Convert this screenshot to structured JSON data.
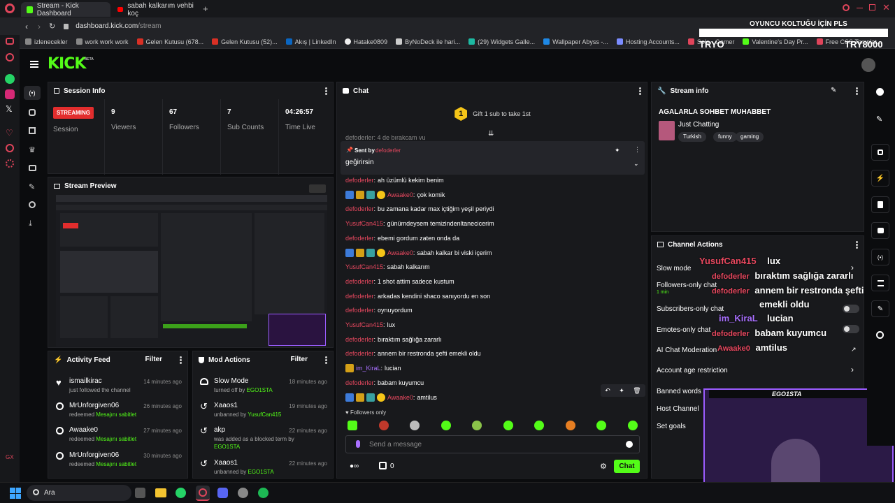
{
  "browser": {
    "tabs": [
      {
        "label": "Stream - Kick Dashboard",
        "active": true
      },
      {
        "label": "sabah kalkarım vehbi koç",
        "active": false
      }
    ],
    "url_domain": "dashboard.kick.com",
    "url_path": "/stream",
    "bookmarks": [
      "izlenecekler",
      "work work work",
      "Gelen Kutusu (678...",
      "Gelen Kutusu (52)...",
      "Akış | LinkedIn",
      "Hatake0809",
      "ByNoDeck ile hari...",
      "(29) Widgets Galle...",
      "Wallpaper Abyss -...",
      "Hosting Accounts...",
      "Solo - Gamer",
      "Valentine's Day Pr...",
      "Free CSS Templat..."
    ]
  },
  "overlay": {
    "banner": "OYUNCU KOLTUĞU İÇİN PLS",
    "left_tag": "TRYO",
    "right_tag": "TRY8000",
    "cam_label": "EGO1STA"
  },
  "header": {
    "logo": "KICK",
    "beta": "BETA"
  },
  "session": {
    "title": "Session Info",
    "status": "STREAMING",
    "status_label": "Session",
    "stats": [
      {
        "value": "9",
        "label": "Viewers"
      },
      {
        "value": "67",
        "label": "Followers"
      },
      {
        "value": "7",
        "label": "Sub Counts"
      },
      {
        "value": "04:26:57",
        "label": "Time Live"
      }
    ]
  },
  "preview": {
    "title": "Stream Preview"
  },
  "activity": {
    "title": "Activity Feed",
    "filter": "Filter",
    "items": [
      {
        "name": "ismailkirac",
        "action": "just followed the channel",
        "highlight": "",
        "time": "14 minutes ago"
      },
      {
        "name": "MrUnforgiven06",
        "action": "redeemed",
        "highlight": "Mesajını sabitlet",
        "time": "26 minutes ago"
      },
      {
        "name": "Awaake0",
        "action": "redeemed",
        "highlight": "Mesajını sabitlet",
        "time": "27 minutes ago"
      },
      {
        "name": "MrUnforgiven06",
        "action": "redeemed",
        "highlight": "Mesajını sabitlet",
        "time": "30 minutes ago"
      }
    ]
  },
  "mod": {
    "title": "Mod Actions",
    "filter": "Filter",
    "items": [
      {
        "name": "Slow Mode",
        "line1": "turned off by",
        "by": "EGO1STA",
        "time": "18 minutes ago"
      },
      {
        "name": "Xaaos1",
        "line1": "unbanned by",
        "by": "YusufCan415",
        "time": "19 minutes ago"
      },
      {
        "name": "akp",
        "line1": "was added as a blocked term by",
        "by": "EGO1STA",
        "time": "22 minutes ago"
      },
      {
        "name": "Xaaos1",
        "line1": "unbanned by",
        "by": "EGO1STA",
        "time": "22 minutes ago"
      }
    ]
  },
  "chat": {
    "title": "Chat",
    "gift_count": "1",
    "gift_text": "Gift 1 sub to take 1st",
    "cut_line": "defoderler: 4 de bırakcam yu",
    "pinned": {
      "sent_by_label": "Sent by",
      "sent_by": "defoderler",
      "text": "geğirirsin"
    },
    "messages": [
      {
        "user": "defoderler",
        "color": "#e8485f",
        "text": "ah üzümlü kekim benim",
        "badges": false
      },
      {
        "user": "Awaake0",
        "color": "#e8485f",
        "text": "çok komik",
        "badges": true
      },
      {
        "user": "defoderler",
        "color": "#e8485f",
        "text": "bu zamana kadar max içtiğim yeşil periydi",
        "badges": false
      },
      {
        "user": "YusufCan415",
        "color": "#e8485f",
        "text": "günümdeysem temizindenltanecicerim",
        "badges": false
      },
      {
        "user": "defoderler",
        "color": "#e8485f",
        "text": "ebemi gordum zaten onda da",
        "badges": false
      },
      {
        "user": "Awaake0",
        "color": "#e8485f",
        "text": "sabah kalkar bi viski içerim",
        "badges": true
      },
      {
        "user": "YusufCan415",
        "color": "#e8485f",
        "text": "sabah kalkarım",
        "badges": false
      },
      {
        "user": "defoderler",
        "color": "#e8485f",
        "text": "1 shot attim sadece kustum",
        "badges": false
      },
      {
        "user": "defoderler",
        "color": "#e8485f",
        "text": "arkadas kendini shaco sanıyordu en son",
        "badges": false
      },
      {
        "user": "defoderler",
        "color": "#e8485f",
        "text": "oynuyordum",
        "badges": false
      },
      {
        "user": "YusufCan415",
        "color": "#e8485f",
        "text": "lux",
        "badges": false
      },
      {
        "user": "defoderler",
        "color": "#e8485f",
        "text": "bıraktım sağlığa zararlı",
        "badges": false
      },
      {
        "user": "defoderler",
        "color": "#e8485f",
        "text": "annem bir restronda şefti emekli oldu",
        "badges": false
      },
      {
        "user": "im_KiraL",
        "color": "#a970ff",
        "text": "lucian",
        "badges": false
      },
      {
        "user": "defoderler",
        "color": "#e8485f",
        "text": "babam kuyumcu",
        "badges": false
      },
      {
        "user": "Awaake0",
        "color": "#e8485f",
        "text": "amtilus",
        "badges": true
      }
    ],
    "followers_only": "Followers only",
    "input_placeholder": "Send a message",
    "points": "0",
    "send": "Chat"
  },
  "stream_info": {
    "title": "Stream info",
    "stream_title": "AGALARLA SOHBET MUHABBET",
    "category": "Just Chatting",
    "tags": [
      "Turkish",
      "funny",
      "gaming"
    ]
  },
  "channel_actions": {
    "title": "Channel Actions",
    "rows": [
      {
        "label": "Slow mode",
        "sub": ""
      },
      {
        "label": "Followers-only chat",
        "sub": "1 min"
      },
      {
        "label": "Subscribers-only chat",
        "sub": ""
      },
      {
        "label": "Emotes-only chat",
        "sub": ""
      },
      {
        "label": "AI Chat Moderation",
        "sub": ""
      },
      {
        "label": "Account age restriction",
        "sub": ""
      },
      {
        "label": "Banned words",
        "sub": ""
      },
      {
        "label": "Host Channel",
        "sub": ""
      },
      {
        "label": "Set goals",
        "sub": ""
      }
    ]
  },
  "chat_overlay": [
    {
      "user": "YusufCan415",
      "text": "lux"
    },
    {
      "user": "defoderler",
      "text": "bıraktım sağlığa zararlı"
    },
    {
      "user": "defoderler",
      "text": "annem bir restronda şefti"
    },
    {
      "user": "",
      "text": "emekli oldu"
    },
    {
      "user": "im_KiraL",
      "text": "lucian"
    },
    {
      "user": "defoderler",
      "text": "babam kuyumcu"
    },
    {
      "user": "Awaake0",
      "text": "amtilus"
    }
  ],
  "taskbar": {
    "search": "Ara"
  },
  "colors": {
    "kick_green": "#53fc18",
    "streaming_red": "#e22d2d",
    "user_red": "#e8485f",
    "user_purple": "#a970ff"
  }
}
